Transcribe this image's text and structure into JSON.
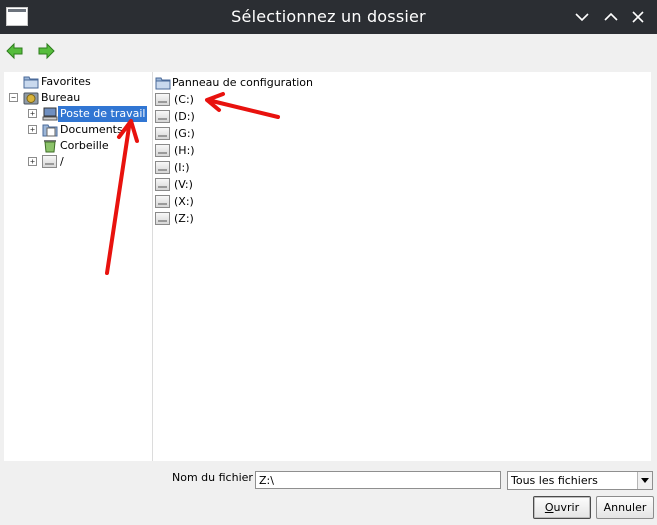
{
  "window": {
    "title": "Sélectionnez un dossier",
    "controls": [
      "minimize",
      "maximize",
      "close"
    ]
  },
  "toolbar": {
    "buttons": [
      {
        "name": "back",
        "icon": "green-arrow-left-icon"
      },
      {
        "name": "forward",
        "icon": "green-arrow-right-icon"
      }
    ]
  },
  "tree": [
    {
      "label": "Favorites",
      "icon": "folder-icon",
      "expander": "",
      "selected": false
    },
    {
      "label": "Bureau",
      "icon": "desktop-icon",
      "expander": "−",
      "selected": false
    },
    {
      "label": "Poste de travail",
      "icon": "computer-icon",
      "expander": "+",
      "selected": true
    },
    {
      "label": "Documents",
      "icon": "documents-icon",
      "expander": "+",
      "selected": false
    },
    {
      "label": "Corbeille",
      "icon": "recycle-bin-icon",
      "expander": "",
      "selected": false
    },
    {
      "label": "/",
      "icon": "drive-icon",
      "expander": "+",
      "selected": false
    }
  ],
  "list": [
    {
      "label": "Panneau de configuration",
      "icon": "folder-icon"
    },
    {
      "label": "(C:)",
      "icon": "drive-icon"
    },
    {
      "label": "(D:)",
      "icon": "drive-icon"
    },
    {
      "label": "(G:)",
      "icon": "drive-icon"
    },
    {
      "label": "(H:)",
      "icon": "drive-icon"
    },
    {
      "label": "(I:)",
      "icon": "drive-icon"
    },
    {
      "label": "(V:)",
      "icon": "drive-icon"
    },
    {
      "label": "(X:)",
      "icon": "drive-icon"
    },
    {
      "label": "(Z:)",
      "icon": "drive-icon"
    }
  ],
  "footer": {
    "filename_label": "Nom du fichier :",
    "filename_value": "Z:\\",
    "filter_value": "Tous les fichiers",
    "ok_label_accel": "O",
    "ok_label_rest": "uvrir",
    "cancel_label": "Annuler"
  },
  "colors": {
    "titlebar": "#2b2e33",
    "selection": "#3176d3",
    "annotation_arrow": "#e8120e",
    "nav_arrow": "#3fa82c"
  }
}
